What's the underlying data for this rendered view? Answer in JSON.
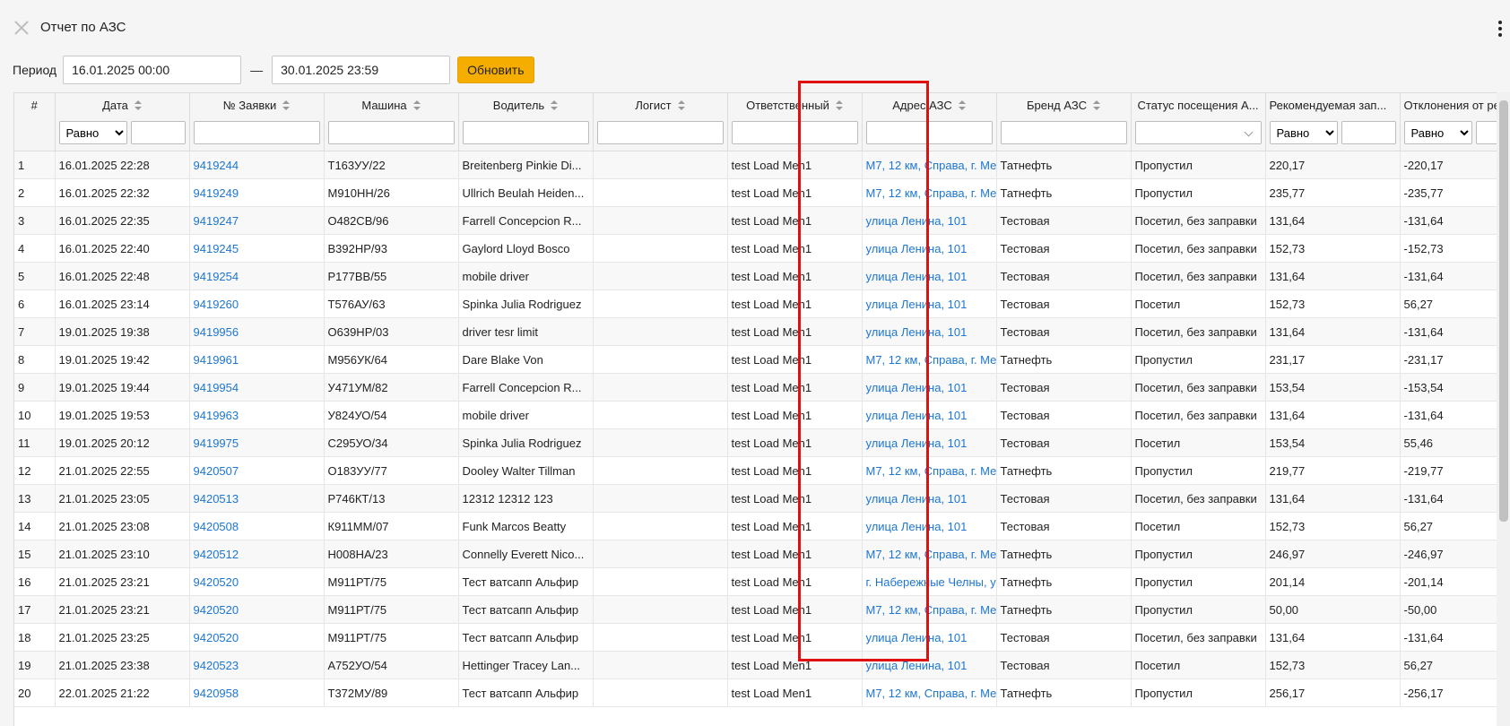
{
  "header": {
    "title": "Отчет по АЗС",
    "close_icon": "close-icon",
    "menu_icon": "more-vertical-icon"
  },
  "period": {
    "label": "Период",
    "from": "16.01.2025 00:00",
    "separator": "—",
    "to": "30.01.2025 23:59",
    "refresh_label": "Обновить"
  },
  "columns": [
    "#",
    "Дата",
    "№ Заявки",
    "Машина",
    "Водитель",
    "Логист",
    "Ответственный",
    "Адрес АЗС",
    "Бренд АЗС",
    "Статус посещения А...",
    "Рекомендуемая зап...",
    "Отклонения от ре"
  ],
  "filters": {
    "date_op": "Равно",
    "recommended_op": "Равно",
    "deviation_op": "Равно",
    "operator_options": [
      "Равно"
    ]
  },
  "rows": [
    [
      "1",
      "16.01.2025 22:28",
      "9419244",
      "Т163УУ/22",
      "Breitenberg Pinkie Di...",
      "",
      "test Load Men1",
      "М7, 12 км, Справа, г. Ме",
      "Татнефть",
      "Пропустил",
      "220,17",
      "-220,17"
    ],
    [
      "2",
      "16.01.2025 22:32",
      "9419249",
      "М910НН/26",
      "Ullrich Beulah Heiden...",
      "",
      "test Load Men1",
      "М7, 12 км, Справа, г. Ме",
      "Татнефть",
      "Пропустил",
      "235,77",
      "-235,77"
    ],
    [
      "3",
      "16.01.2025 22:35",
      "9419247",
      "О482СВ/96",
      "Farrell Concepcion R...",
      "",
      "test Load Men1",
      "улица Ленина, 101",
      "Тестовая",
      "Посетил, без заправки",
      "131,64",
      "-131,64"
    ],
    [
      "4",
      "16.01.2025 22:40",
      "9419245",
      "В392НР/93",
      "Gaylord Lloyd Bosco",
      "",
      "test Load Men1",
      "улица Ленина, 101",
      "Тестовая",
      "Посетил, без заправки",
      "152,73",
      "-152,73"
    ],
    [
      "5",
      "16.01.2025 22:48",
      "9419254",
      "Р177ВВ/55",
      "mobile driver",
      "",
      "test Load Men1",
      "улица Ленина, 101",
      "Тестовая",
      "Посетил, без заправки",
      "131,64",
      "-131,64"
    ],
    [
      "6",
      "16.01.2025 23:14",
      "9419260",
      "Т576АУ/63",
      "Spinka Julia Rodriguez",
      "",
      "test Load Men1",
      "улица Ленина, 101",
      "Тестовая",
      "Посетил",
      "152,73",
      "56,27"
    ],
    [
      "7",
      "19.01.2025 19:38",
      "9419956",
      "О639НР/03",
      "driver tesr limit",
      "",
      "test Load Men1",
      "улица Ленина, 101",
      "Тестовая",
      "Посетил, без заправки",
      "131,64",
      "-131,64"
    ],
    [
      "8",
      "19.01.2025 19:42",
      "9419961",
      "М956УК/64",
      "Dare Blake Von",
      "",
      "test Load Men1",
      "М7, 12 км, Справа, г. Ме",
      "Татнефть",
      "Пропустил",
      "231,17",
      "-231,17"
    ],
    [
      "9",
      "19.01.2025 19:44",
      "9419954",
      "У471УМ/82",
      "Farrell Concepcion R...",
      "",
      "test Load Men1",
      "улица Ленина, 101",
      "Тестовая",
      "Посетил, без заправки",
      "153,54",
      "-153,54"
    ],
    [
      "10",
      "19.01.2025 19:53",
      "9419963",
      "У824УО/54",
      "mobile driver",
      "",
      "test Load Men1",
      "улица Ленина, 101",
      "Тестовая",
      "Посетил, без заправки",
      "131,64",
      "-131,64"
    ],
    [
      "11",
      "19.01.2025 20:12",
      "9419975",
      "С295УО/34",
      "Spinka Julia Rodriguez",
      "",
      "test Load Men1",
      "улица Ленина, 101",
      "Тестовая",
      "Посетил",
      "153,54",
      "55,46"
    ],
    [
      "12",
      "21.01.2025 22:55",
      "9420507",
      "О183УУ/77",
      "Dooley Walter Tillman",
      "",
      "test Load Men1",
      "М7, 12 км, Справа, г. Ме",
      "Татнефть",
      "Пропустил",
      "219,77",
      "-219,77"
    ],
    [
      "13",
      "21.01.2025 23:05",
      "9420513",
      "Р746КТ/13",
      "12312 12312 123",
      "",
      "test Load Men1",
      "улица Ленина, 101",
      "Тестовая",
      "Посетил, без заправки",
      "131,64",
      "-131,64"
    ],
    [
      "14",
      "21.01.2025 23:08",
      "9420508",
      "К911ММ/07",
      "Funk Marcos Beatty",
      "",
      "test Load Men1",
      "улица Ленина, 101",
      "Тестовая",
      "Посетил",
      "152,73",
      "56,27"
    ],
    [
      "15",
      "21.01.2025 23:10",
      "9420512",
      "Н008НА/23",
      "Connelly Everett Nico...",
      "",
      "test Load Men1",
      "М7, 12 км, Справа, г. Ме",
      "Татнефть",
      "Пропустил",
      "246,97",
      "-246,97"
    ],
    [
      "16",
      "21.01.2025 23:21",
      "9420520",
      "М911РТ/75",
      "Тест ватсапп Альфир",
      "",
      "test Load Men1",
      "г. Набережные Челны, у",
      "Татнефть",
      "Пропустил",
      "201,14",
      "-201,14"
    ],
    [
      "17",
      "21.01.2025 23:21",
      "9420520",
      "М911РТ/75",
      "Тест ватсапп Альфир",
      "",
      "test Load Men1",
      "М7, 12 км, Справа, г. Ме",
      "Татнефть",
      "Пропустил",
      "50,00",
      "-50,00"
    ],
    [
      "18",
      "21.01.2025 23:25",
      "9420520",
      "М911РТ/75",
      "Тест ватсапп Альфир",
      "",
      "test Load Men1",
      "улица Ленина, 101",
      "Тестовая",
      "Посетил, без заправки",
      "131,64",
      "-131,64"
    ],
    [
      "19",
      "21.01.2025 23:38",
      "9420523",
      "А752УО/54",
      "Hettinger Tracey Lan...",
      "",
      "test Load Men1",
      "улица Ленина, 101",
      "Тестовая",
      "Посетил",
      "152,73",
      "56,27"
    ],
    [
      "20",
      "22.01.2025 21:22",
      "9420958",
      "Т372МУ/89",
      "Тест ватсапп Альфир",
      "",
      "test Load Men1",
      "М7, 12 км, Справа, г. Ме",
      "Татнефть",
      "Пропустил",
      "256,17",
      "-256,17"
    ]
  ],
  "colors": {
    "accent": "#f5ad00",
    "link": "#1d76d2",
    "highlight": "#e01010"
  }
}
